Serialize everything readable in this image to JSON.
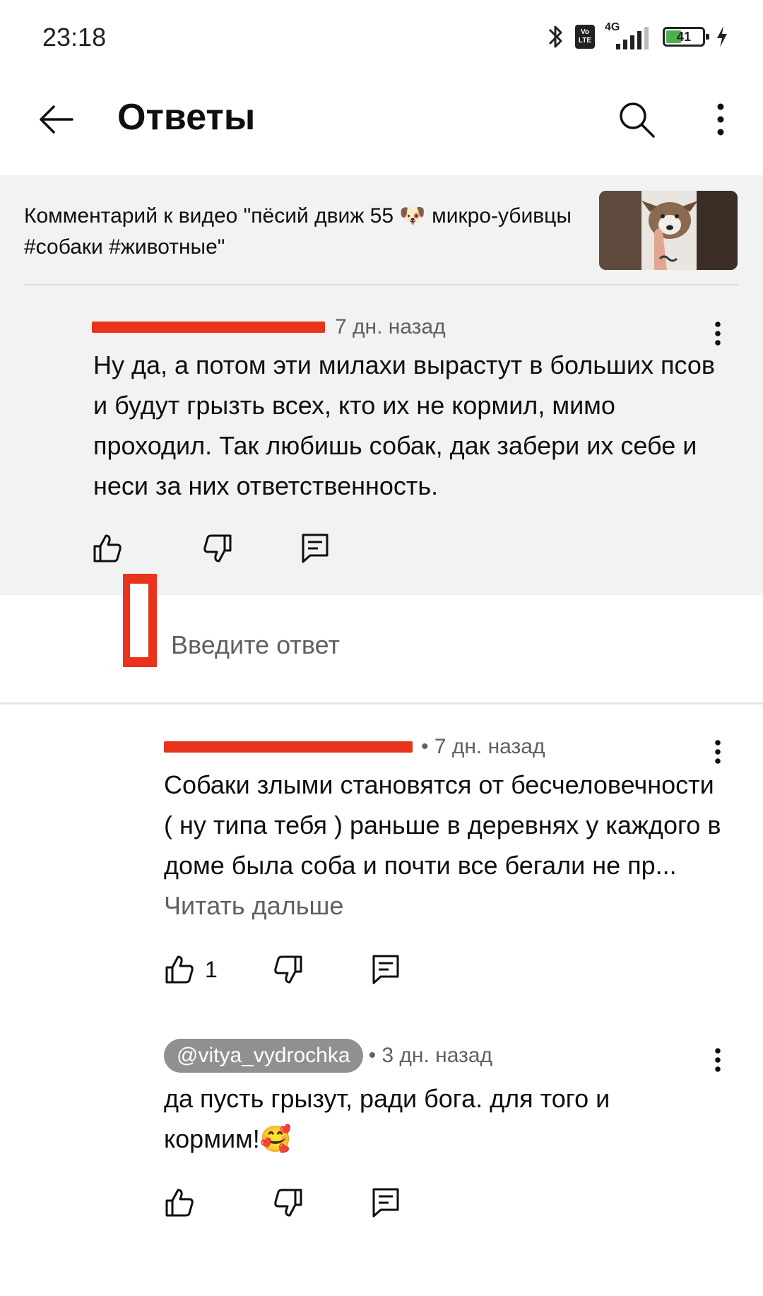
{
  "status_bar": {
    "time": "23:18",
    "volte": [
      "Vo",
      "LTE"
    ],
    "network": "4G",
    "battery": "41",
    "battery_level": 0.41
  },
  "app_bar": {
    "title": "Ответы"
  },
  "parent": {
    "video_ref": "Комментарий к видео \"пёсий движ 55 🐶 микро-убивцы #собаки #животные\"",
    "comment": {
      "time": "7 дн. назад",
      "text": "Ну да, а потом эти милахи вырастут в больших псов и будут грызть всех, кто их не кормил, мимо проходил. Так любишь собак, дак забери их себе и неси за них ответственность."
    }
  },
  "reply_input": {
    "placeholder": "Введите ответ"
  },
  "replies": [
    {
      "time": "• 7 дн. назад",
      "text": "Собаки злыми становятся от бесчеловечности ( ну типа тебя ) раньше в деревнях у каждого в доме была соба и почти все бегали не пр...",
      "read_more": "Читать дальше",
      "likes": "1"
    },
    {
      "handle": "@vitya_vydrochka",
      "time": "• 3 дн. назад",
      "text": "да пусть грызут, ради бога. для того и кормим!🥰",
      "likes": ""
    }
  ],
  "icons": {
    "back": "back-arrow-icon",
    "search": "search-icon",
    "more": "more-vert-icon",
    "like": "thumb-up-icon",
    "dislike": "thumb-down-icon",
    "reply": "comment-icon"
  }
}
